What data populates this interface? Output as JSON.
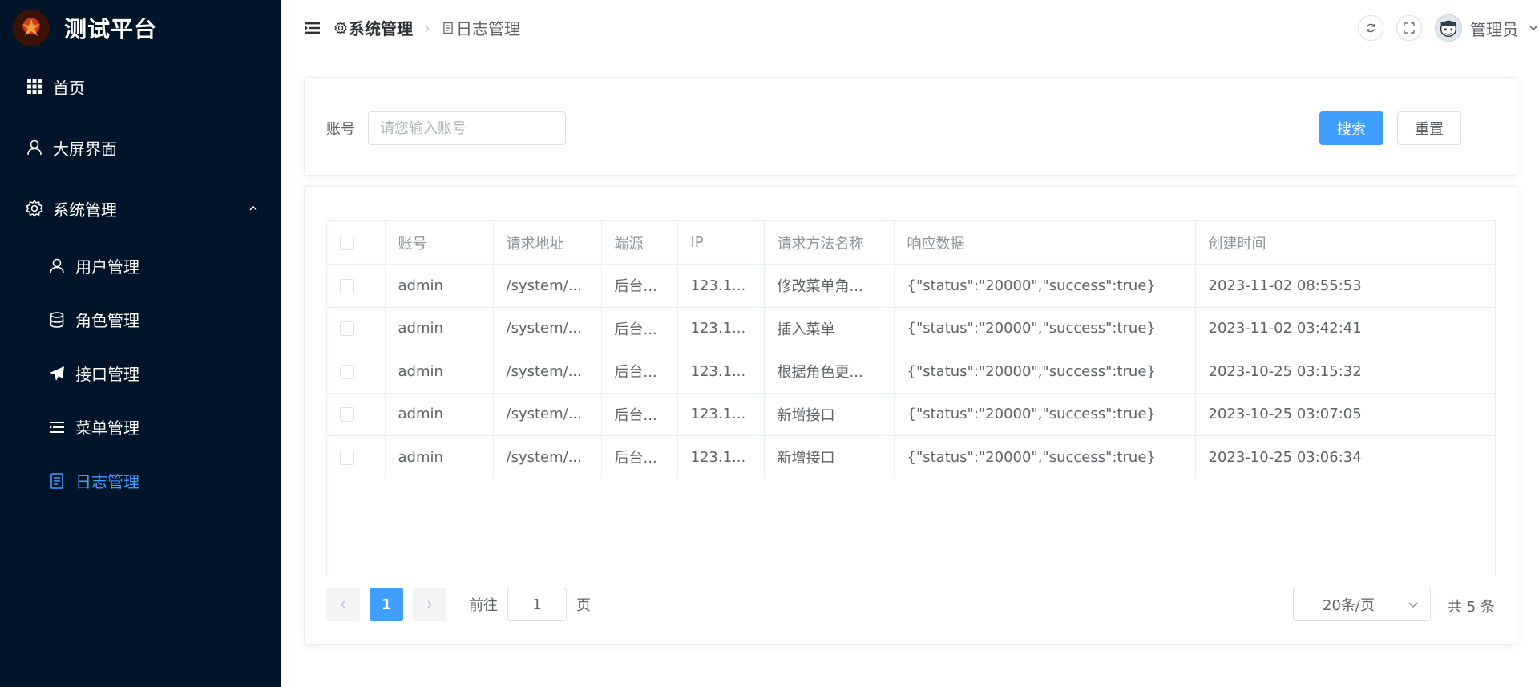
{
  "app": {
    "title": "测试平台"
  },
  "sidebar": {
    "items": [
      {
        "label": "首页",
        "icon": "grid-icon"
      },
      {
        "label": "大屏界面",
        "icon": "user-icon"
      },
      {
        "label": "系统管理",
        "icon": "gear-icon",
        "expanded": true
      }
    ],
    "submenu": [
      {
        "label": "用户管理",
        "icon": "user-icon"
      },
      {
        "label": "角色管理",
        "icon": "database-icon"
      },
      {
        "label": "接口管理",
        "icon": "send-icon"
      },
      {
        "label": "菜单管理",
        "icon": "menu-list-icon"
      },
      {
        "label": "日志管理",
        "icon": "document-icon",
        "active": true
      }
    ],
    "colors": {
      "background": "#001529",
      "active": "#409eff"
    }
  },
  "header": {
    "breadcrumb": [
      "系统管理",
      "日志管理"
    ],
    "user_name": "管理员"
  },
  "search": {
    "label": "账号",
    "placeholder": "请您输入账号",
    "value": "",
    "search_button": "搜索",
    "reset_button": "重置"
  },
  "table": {
    "columns": [
      "账号",
      "请求地址",
      "端源",
      "IP",
      "请求方法名称",
      "响应数据",
      "创建时间"
    ],
    "rows": [
      [
        "admin",
        "/system/...",
        "后台...",
        "123.1...",
        "修改菜单角...",
        "{\"status\":\"20000\",\"success\":true}",
        "2023-11-02 08:55:53"
      ],
      [
        "admin",
        "/system/...",
        "后台...",
        "123.1...",
        "插入菜单",
        "{\"status\":\"20000\",\"success\":true}",
        "2023-11-02 03:42:41"
      ],
      [
        "admin",
        "/system/...",
        "后台...",
        "123.1...",
        "根据角色更...",
        "{\"status\":\"20000\",\"success\":true}",
        "2023-10-25 03:15:32"
      ],
      [
        "admin",
        "/system/...",
        "后台...",
        "123.1...",
        "新增接口",
        "{\"status\":\"20000\",\"success\":true}",
        "2023-10-25 03:07:05"
      ],
      [
        "admin",
        "/system/...",
        "后台...",
        "123.1...",
        "新增接口",
        "{\"status\":\"20000\",\"success\":true}",
        "2023-10-25 03:06:34"
      ]
    ]
  },
  "pagination": {
    "current_page": "1",
    "goto_prefix": "前往",
    "goto_value": "1",
    "goto_suffix": "页",
    "page_size": "20条/页",
    "total_text": "共 5 条"
  },
  "colors": {
    "primary": "#409eff"
  }
}
